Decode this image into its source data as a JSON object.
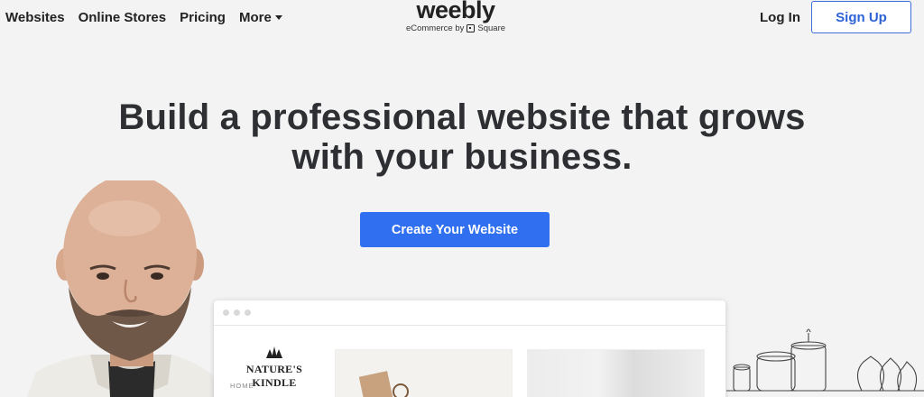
{
  "nav": {
    "items": [
      "Websites",
      "Online Stores",
      "Pricing"
    ],
    "more_label": "More",
    "login_label": "Log In",
    "signup_label": "Sign Up"
  },
  "logo": {
    "word": "weebly",
    "tagline_prefix": "eCommerce by",
    "tagline_brand": "Square"
  },
  "hero": {
    "line1": "Build a professional website that grows",
    "line2": "with your business."
  },
  "cta": {
    "label": "Create Your Website"
  },
  "mockup": {
    "brand_name": "NATURE'S KINDLE",
    "nav_home": "HOME"
  },
  "colors": {
    "accent": "#2f6ff0",
    "background": "#f3f3f3"
  }
}
